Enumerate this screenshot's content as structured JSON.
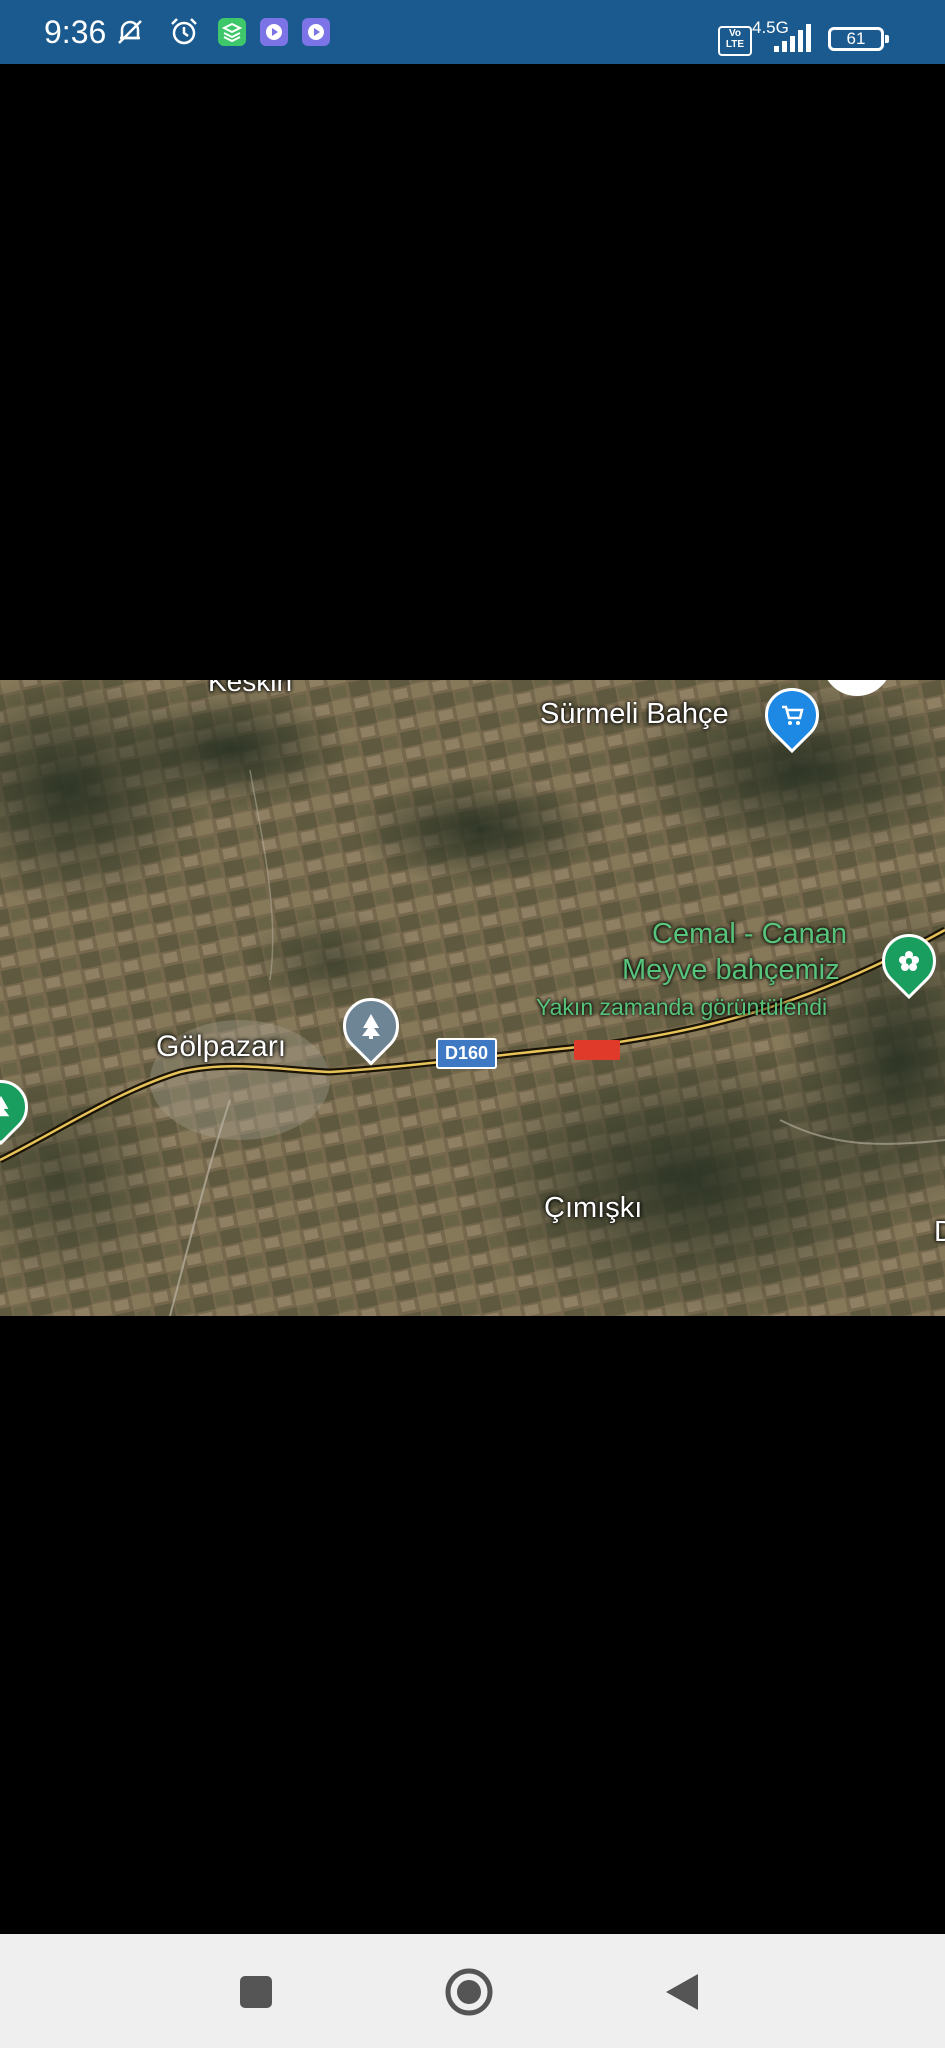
{
  "status_bar": {
    "time": "9:36",
    "network": "4.5G",
    "volte": "Vo\nLTE",
    "battery": "61",
    "icons": [
      "mute-icon",
      "alarm-icon",
      "app-stack-icon",
      "video-app-icon",
      "video-app-icon"
    ]
  },
  "map": {
    "places": {
      "top_partial": "Keskin",
      "surmeli": "Sürmeli Bahçe",
      "cemal_line1": "Cemal - Canan",
      "cemal_line2": "Meyve bahçemiz",
      "recent": "Yakın zamanda görüntülendi",
      "golpazari": "Gölpazarı",
      "cimiski": "Çımışkı",
      "right_partial": "D"
    },
    "road_badge": "D160",
    "colors": {
      "shop_pin": "#1e88e5",
      "garden_pin": "#1a9e5f",
      "park_pin": "#6e8596",
      "road_badge": "#3f79c4",
      "speed_badge": "#e03a2a"
    }
  },
  "navbar": {
    "buttons": [
      "recent-apps",
      "home",
      "back"
    ]
  }
}
